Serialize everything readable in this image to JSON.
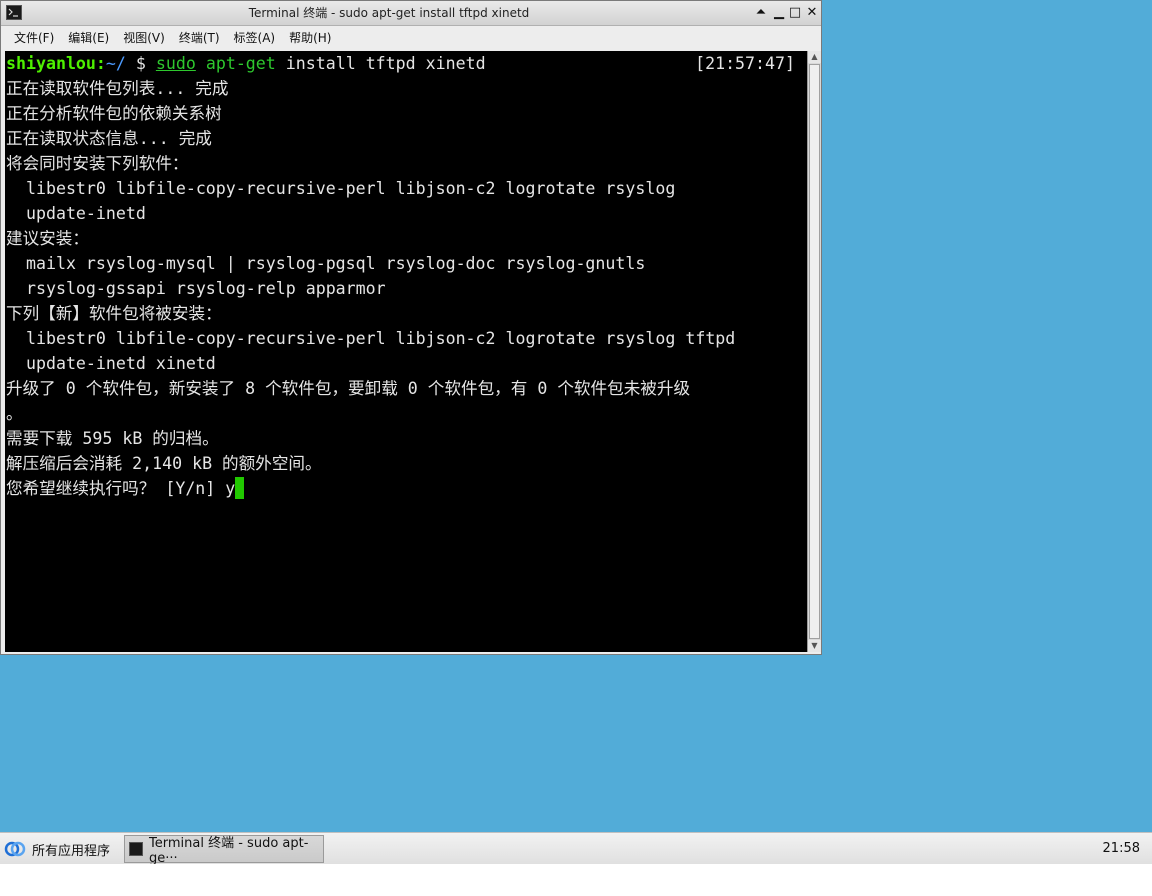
{
  "window": {
    "title": "Terminal 终端 - sudo apt-get install tftpd xinetd",
    "buttons": {
      "shade": "⏶",
      "minimize": "▁",
      "maximize": "□",
      "close": "✕"
    }
  },
  "menubar": {
    "items": [
      {
        "label": "文件(F)"
      },
      {
        "label": "编辑(E)"
      },
      {
        "label": "视图(V)"
      },
      {
        "label": "终端(T)"
      },
      {
        "label": "标签(A)"
      },
      {
        "label": "帮助(H)"
      }
    ]
  },
  "terminal": {
    "prompt_user": "shiyanlou:",
    "prompt_path": "~/",
    "prompt_symbol": " $ ",
    "cmd_sudo": "sudo",
    "cmd_space": " ",
    "cmd_aptget": "apt-get",
    "cmd_args": " install tftpd xinetd",
    "timestamp": "[21:57:47]",
    "lines": [
      "正在读取软件包列表... 完成",
      "正在分析软件包的依赖关系树",
      "正在读取状态信息... 完成",
      "将会同时安装下列软件：",
      "  libestr0 libfile-copy-recursive-perl libjson-c2 logrotate rsyslog",
      "  update-inetd",
      "建议安装：",
      "  mailx rsyslog-mysql | rsyslog-pgsql rsyslog-doc rsyslog-gnutls",
      "  rsyslog-gssapi rsyslog-relp apparmor",
      "下列【新】软件包将被安装：",
      "  libestr0 libfile-copy-recursive-perl libjson-c2 logrotate rsyslog tftpd",
      "  update-inetd xinetd",
      "升级了 0 个软件包，新安装了 8 个软件包，要卸载 0 个软件包，有 0 个软件包未被升级",
      "。",
      "需要下载 595 kB 的归档。",
      "解压缩后会消耗 2,140 kB 的额外空间。"
    ],
    "input_prompt": "您希望继续执行吗？ [Y/n] ",
    "input_value": "y"
  },
  "taskbar": {
    "start_label": "所有应用程序",
    "task_label": "Terminal 终端 - sudo apt-ge···",
    "clock": "21:58"
  },
  "colors": {
    "desktop": "#52acd8",
    "terminal_bg": "#000000",
    "prompt_user": "#4ef000",
    "prompt_path": "#4c9bff",
    "command": "#2ec82e",
    "cursor": "#21c800"
  }
}
